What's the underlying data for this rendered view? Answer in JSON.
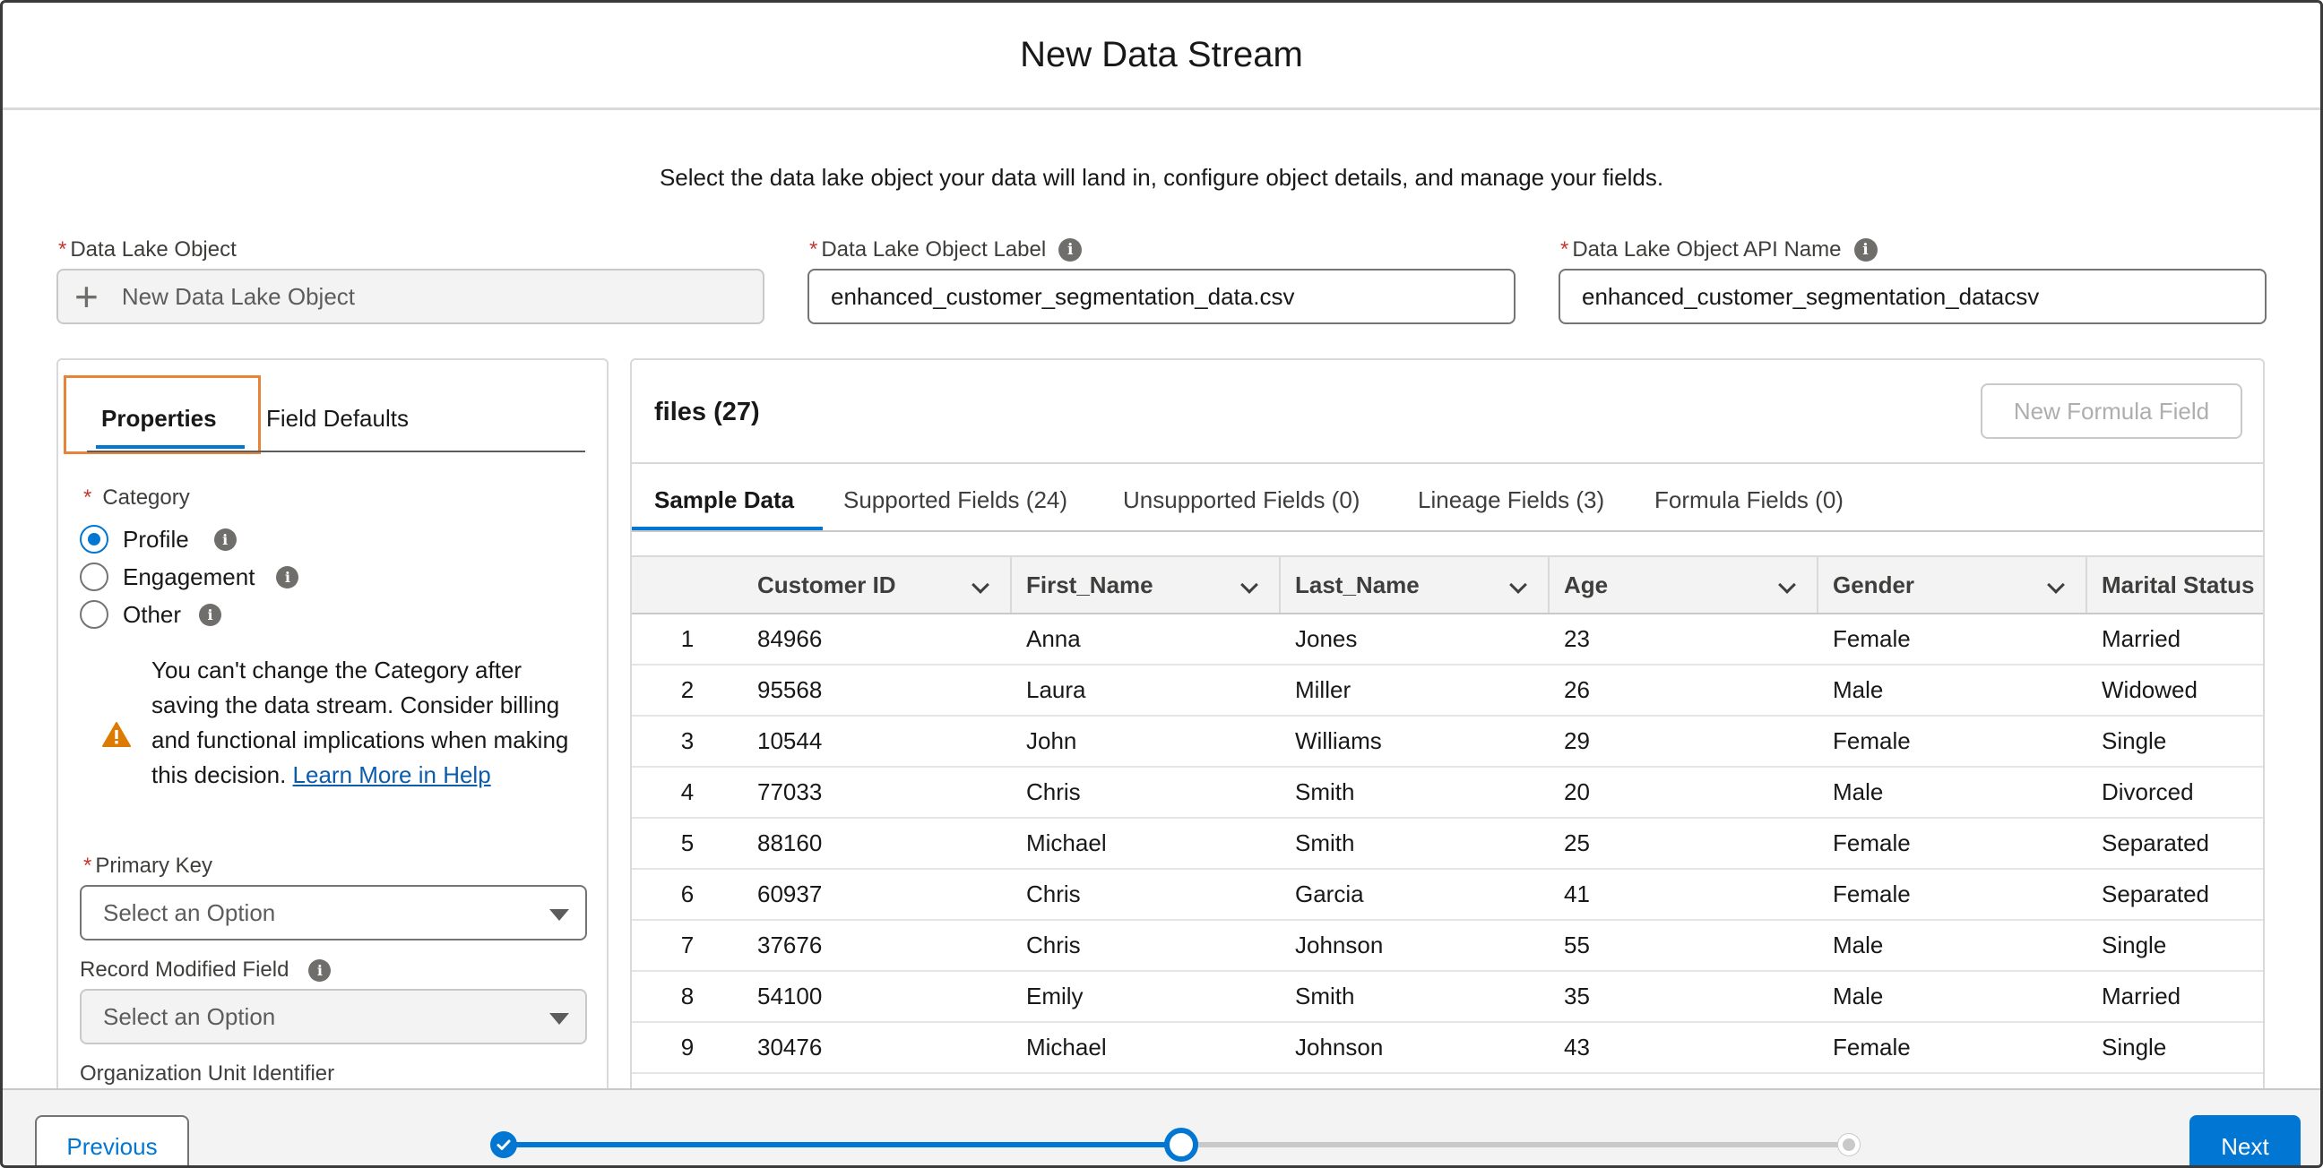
{
  "header": {
    "title": "New Data Stream"
  },
  "subtitle": "Select the data lake object your data will land in, configure object details, and manage your fields.",
  "fields": {
    "dlo": {
      "label": "Data Lake Object",
      "placeholder": "New Data Lake Object"
    },
    "dlo_label": {
      "label": "Data Lake Object Label",
      "value": "enhanced_customer_segmentation_data.csv"
    },
    "dlo_api": {
      "label": "Data Lake Object API Name",
      "value": "enhanced_customer_segmentation_datacsv"
    }
  },
  "left_panel": {
    "tabs": [
      "Properties",
      "Field Defaults"
    ],
    "category_label": "Category",
    "category_options": [
      "Profile",
      "Engagement",
      "Other"
    ],
    "selected_category": "Profile",
    "warning": "You can't change the Category after saving the data stream. Consider billing and functional implications when making this decision.",
    "warning_link": "Learn More in Help",
    "primary_key": {
      "label": "Primary Key",
      "placeholder": "Select an Option"
    },
    "record_modified": {
      "label": "Record Modified Field",
      "placeholder": "Select an Option"
    },
    "org_unit": {
      "label": "Organization Unit Identifier"
    }
  },
  "right_panel": {
    "title": "files (27)",
    "new_formula_button": "New Formula Field",
    "tabs": [
      "Sample Data",
      "Supported Fields (24)",
      "Unsupported Fields (0)",
      "Lineage Fields (3)",
      "Formula Fields (0)"
    ],
    "active_tab": "Sample Data",
    "columns": [
      "Customer ID",
      "First_Name",
      "Last_Name",
      "Age",
      "Gender",
      "Marital Status"
    ],
    "rows": [
      [
        "1",
        "84966",
        "Anna",
        "Jones",
        "23",
        "Female",
        "Married"
      ],
      [
        "2",
        "95568",
        "Laura",
        "Miller",
        "26",
        "Male",
        "Widowed"
      ],
      [
        "3",
        "10544",
        "John",
        "Williams",
        "29",
        "Female",
        "Single"
      ],
      [
        "4",
        "77033",
        "Chris",
        "Smith",
        "20",
        "Male",
        "Divorced"
      ],
      [
        "5",
        "88160",
        "Michael",
        "Smith",
        "25",
        "Female",
        "Separated"
      ],
      [
        "6",
        "60937",
        "Chris",
        "Garcia",
        "41",
        "Female",
        "Separated"
      ],
      [
        "7",
        "37676",
        "Chris",
        "Johnson",
        "55",
        "Male",
        "Single"
      ],
      [
        "8",
        "54100",
        "Emily",
        "Smith",
        "35",
        "Male",
        "Married"
      ],
      [
        "9",
        "30476",
        "Michael",
        "Johnson",
        "43",
        "Female",
        "Single"
      ]
    ]
  },
  "footer": {
    "previous": "Previous",
    "next": "Next",
    "progress": {
      "current_step": 2,
      "total_steps": 3
    }
  },
  "colors": {
    "brand": "#0176d3",
    "required": "#c23934",
    "warning": "#dd7a01",
    "highlight_border": "#e8833a"
  }
}
